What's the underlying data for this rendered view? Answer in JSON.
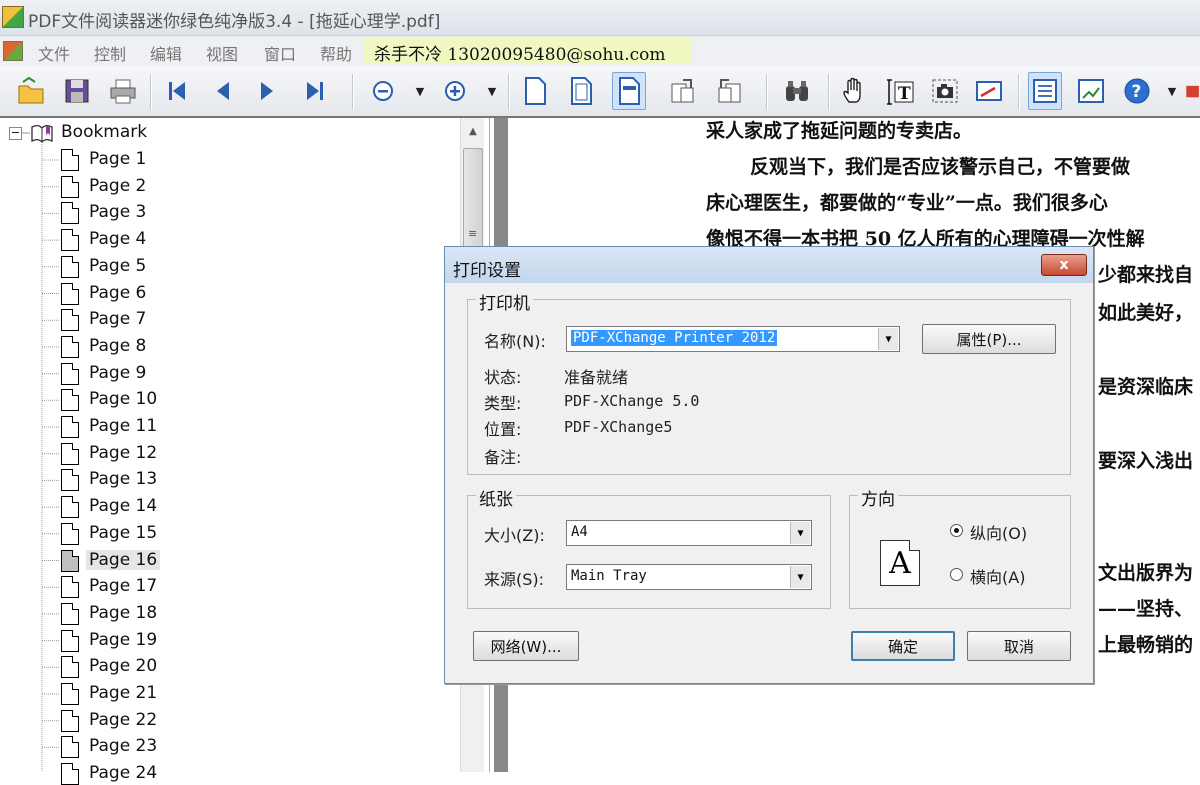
{
  "window": {
    "title": "PDF文件阅读器迷你绿色纯净版3.4 - [拖延心理学.pdf]"
  },
  "menu": {
    "items": [
      "文件",
      "控制",
      "编辑",
      "视图",
      "窗口",
      "帮助"
    ],
    "promo": "杀手不冷 13020095480@sohu.com"
  },
  "toolbar": {
    "icons": [
      "open-icon",
      "save-icon",
      "print-icon",
      "first-page-icon",
      "prev-page-icon",
      "next-page-icon",
      "last-page-icon",
      "zoom-out-icon",
      "zoom-in-icon",
      "actual-size-icon",
      "fit-page-icon",
      "fit-width-icon",
      "rotate-cw-icon",
      "rotate-ccw-icon",
      "find-icon",
      "hand-tool-icon",
      "text-select-icon",
      "snapshot-icon",
      "annotate-icon",
      "bookmarks-panel-icon",
      "thumbnails-panel-icon",
      "help-icon"
    ],
    "active": "fit-width-icon"
  },
  "sidebar": {
    "root_label": "Bookmark",
    "pages": [
      "Page 1",
      "Page 2",
      "Page 3",
      "Page 4",
      "Page 5",
      "Page 6",
      "Page 7",
      "Page 8",
      "Page 9",
      "Page 10",
      "Page 11",
      "Page 12",
      "Page 13",
      "Page 14",
      "Page 15",
      "Page 16",
      "Page 17",
      "Page 18",
      "Page 19",
      "Page 20",
      "Page 21",
      "Page 22",
      "Page 23",
      "Page 24"
    ],
    "selected": "Page 16"
  },
  "document": {
    "lines": [
      "采人家成了拖延问题的专卖店。",
      "反观当下，我们是否应该警示自己，不管要做",
      "床心理医生，都要做的“专业”一点。我们很多心",
      "像恨不得一本书把 50 亿人所有的心理障碍一次性解",
      "少都来找自",
      "如此美好，",
      "是资深临床",
      "要深入浅出",
      "文出版界为",
      "——坚持、",
      "上最畅销的"
    ]
  },
  "dialog": {
    "title": "打印设置",
    "close_label": "x",
    "printer_group": "打印机",
    "name_label": "名称(N):",
    "printer_name": "PDF-XChange Printer 2012",
    "properties_button": "属性(P)...",
    "status_label": "状态:",
    "status_value": "准备就绪",
    "type_label": "类型:",
    "type_value": "PDF-XChange 5.0",
    "location_label": "位置:",
    "location_value": "PDF-XChange5",
    "comment_label": "备注:",
    "paper_group": "纸张",
    "size_label": "大小(Z):",
    "size_value": "A4",
    "source_label": "来源(S):",
    "source_value": "Main Tray",
    "orientation_group": "方向",
    "orientation_glyph": "A",
    "portrait_label": "纵向(O)",
    "landscape_label": "横向(A)",
    "orientation_selected": "portrait",
    "network_button": "网络(W)...",
    "ok_button": "确定",
    "cancel_button": "取消"
  }
}
